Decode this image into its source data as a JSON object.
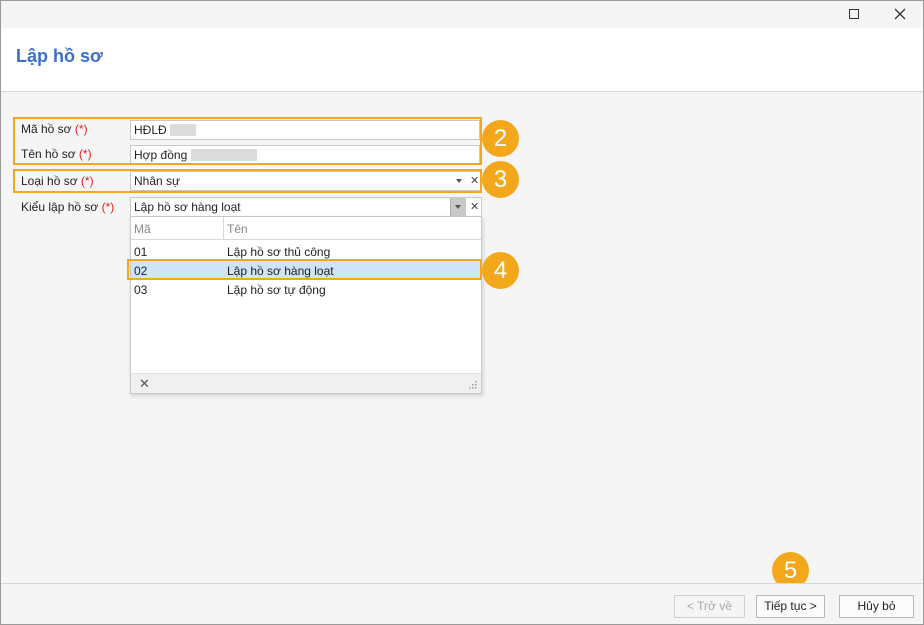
{
  "window": {
    "maximize_icon": "maximize-icon",
    "close_icon": "close-icon"
  },
  "header": {
    "title": "Lập hồ sơ"
  },
  "form": {
    "required_mark": "(*)",
    "ma_ho_so": {
      "label": "Mã hồ sơ",
      "value": "HĐLĐ"
    },
    "ten_ho_so": {
      "label": "Tên hồ sơ",
      "value": "Hợp đồng"
    },
    "loai_ho_so": {
      "label": "Loại hồ sơ",
      "value": "Nhân sự"
    },
    "kieu_lap_ho_so": {
      "label": "Kiểu lập hồ sơ",
      "value": "Lập hồ sơ hàng loạt"
    }
  },
  "dropdown": {
    "columns": [
      "Mã",
      "Tên"
    ],
    "rows": [
      {
        "code": "01",
        "name": "Lập hồ sơ thủ công"
      },
      {
        "code": "02",
        "name": "Lập hồ sơ hàng loạt"
      },
      {
        "code": "03",
        "name": "Lập hồ sơ tự động"
      }
    ],
    "selected_code": "02"
  },
  "callouts": [
    "2",
    "3",
    "4",
    "5"
  ],
  "buttons": {
    "back": "< Trở về",
    "next": "Tiếp tục >",
    "cancel": "Hủy bỏ"
  },
  "colors": {
    "highlight": "#f3a81c",
    "title": "#3b6fc9",
    "required": "#e02020",
    "selected_row": "#cfe4f7"
  }
}
